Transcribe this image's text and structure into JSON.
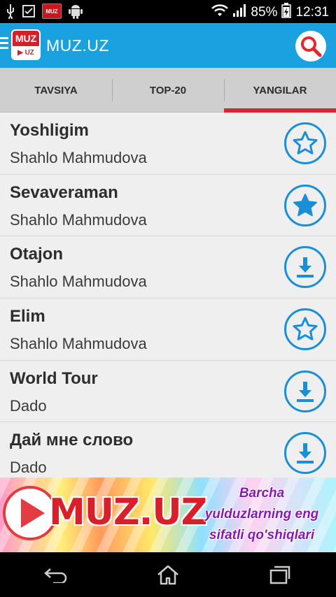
{
  "status_bar": {
    "battery": "85%",
    "time": "12:31",
    "notification_app": "MUZ"
  },
  "app_bar": {
    "title": "MUZ.UZ",
    "logo_top": "MUZ",
    "logo_bottom": "▶ UZ"
  },
  "tabs": [
    {
      "label": "TAVSIYA",
      "active": false
    },
    {
      "label": "TOP-20",
      "active": false
    },
    {
      "label": "YANGILAR",
      "active": true
    }
  ],
  "songs": [
    {
      "title": "Yoshligim",
      "artist": "Shahlo Mahmudova",
      "action": "star-outline-icon"
    },
    {
      "title": "Sevaveraman",
      "artist": "Shahlo Mahmudova",
      "action": "star-filled-icon"
    },
    {
      "title": "Otajon",
      "artist": "Shahlo Mahmudova",
      "action": "download-icon"
    },
    {
      "title": "Elim",
      "artist": "Shahlo Mahmudova",
      "action": "star-outline-icon"
    },
    {
      "title": "World Tour",
      "artist": "Dado",
      "action": "download-icon"
    },
    {
      "title": "Дай мне слово",
      "artist": "Dado",
      "action": "download-icon"
    }
  ],
  "banner": {
    "brand": "MUZ.UZ",
    "slogan_1": "Barcha",
    "slogan_2": "yulduzlarning eng",
    "slogan_3": "sifatli qo'shiqlari"
  },
  "colors": {
    "app_bar": "#1aa1e0",
    "accent_tab": "#d12a2f",
    "icon_blue": "#1a8fd6"
  }
}
